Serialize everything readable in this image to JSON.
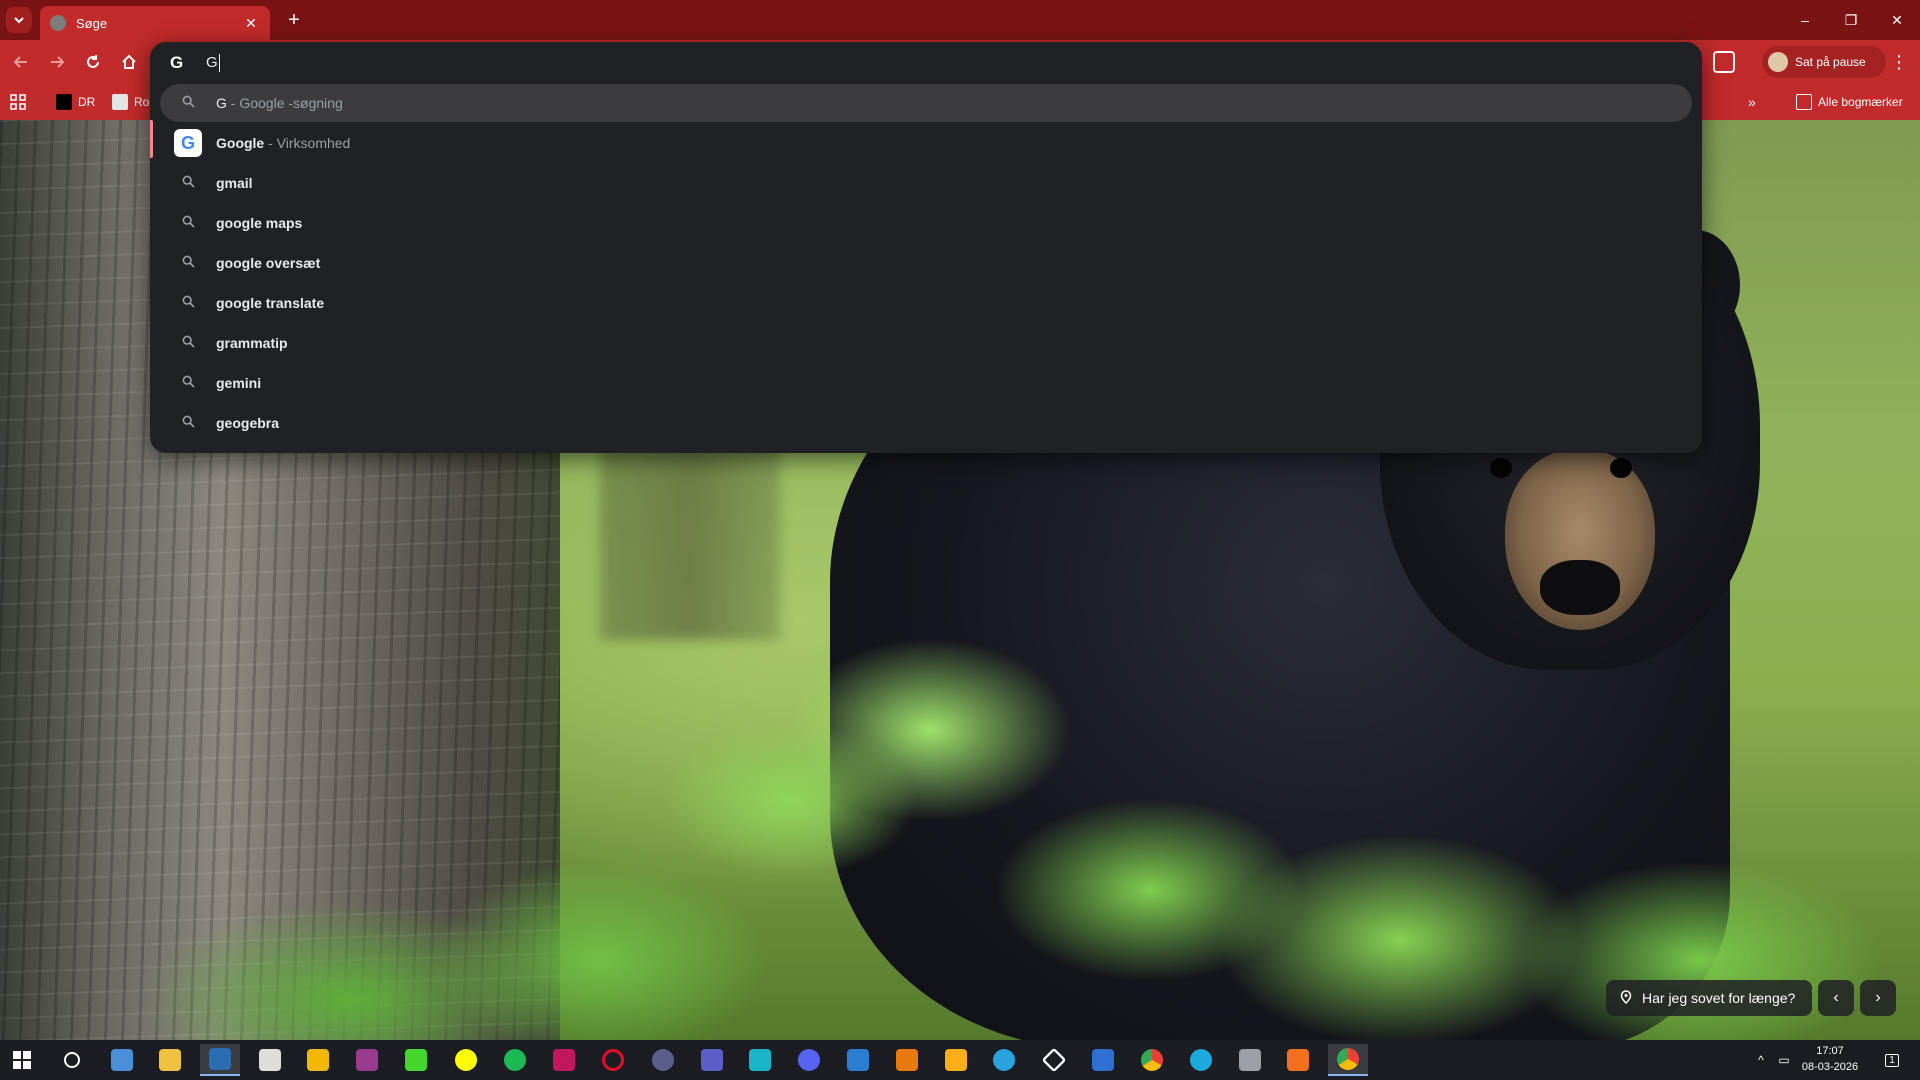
{
  "window": {
    "tab_title": "Søge",
    "controls": [
      "–",
      "❐",
      "✕"
    ]
  },
  "toolbar": {
    "profile_label": "Sat på pause"
  },
  "bookmarks": {
    "items": [
      {
        "label": "DR"
      },
      {
        "label": "Rol"
      }
    ],
    "all_bookmarks_label": "Alle bogmærker"
  },
  "omnibox": {
    "input_value": "G",
    "search_engine_icon": "google-g-icon",
    "suggestions": [
      {
        "kind": "search",
        "query": "G",
        "suffix": " - Google -søgning",
        "selected": true
      },
      {
        "kind": "entity",
        "query": "Google",
        "suffix": " - Virksomhed",
        "selected": false
      },
      {
        "kind": "search",
        "query": "gmail",
        "suffix": "",
        "selected": false
      },
      {
        "kind": "search",
        "query": "google maps",
        "suffix": "",
        "selected": false
      },
      {
        "kind": "search",
        "query": "google oversæt",
        "suffix": "",
        "selected": false
      },
      {
        "kind": "search",
        "query": "google translate",
        "suffix": "",
        "selected": false
      },
      {
        "kind": "search",
        "query": "grammatip",
        "suffix": "",
        "selected": false
      },
      {
        "kind": "search",
        "query": "gemini",
        "suffix": "",
        "selected": false
      },
      {
        "kind": "search",
        "query": "geogebra",
        "suffix": "",
        "selected": false
      }
    ]
  },
  "ntp": {
    "attribution": "Har jeg sovet for længe?"
  },
  "taskbar": {
    "time": "17:07",
    "date": "08-03-2026",
    "notification_count": "1"
  },
  "colors": {
    "frame": "#7a1414",
    "toolbar": "#c22b2b",
    "omnibox_bg": "#202124",
    "selected_row": "#3c3c3f"
  }
}
